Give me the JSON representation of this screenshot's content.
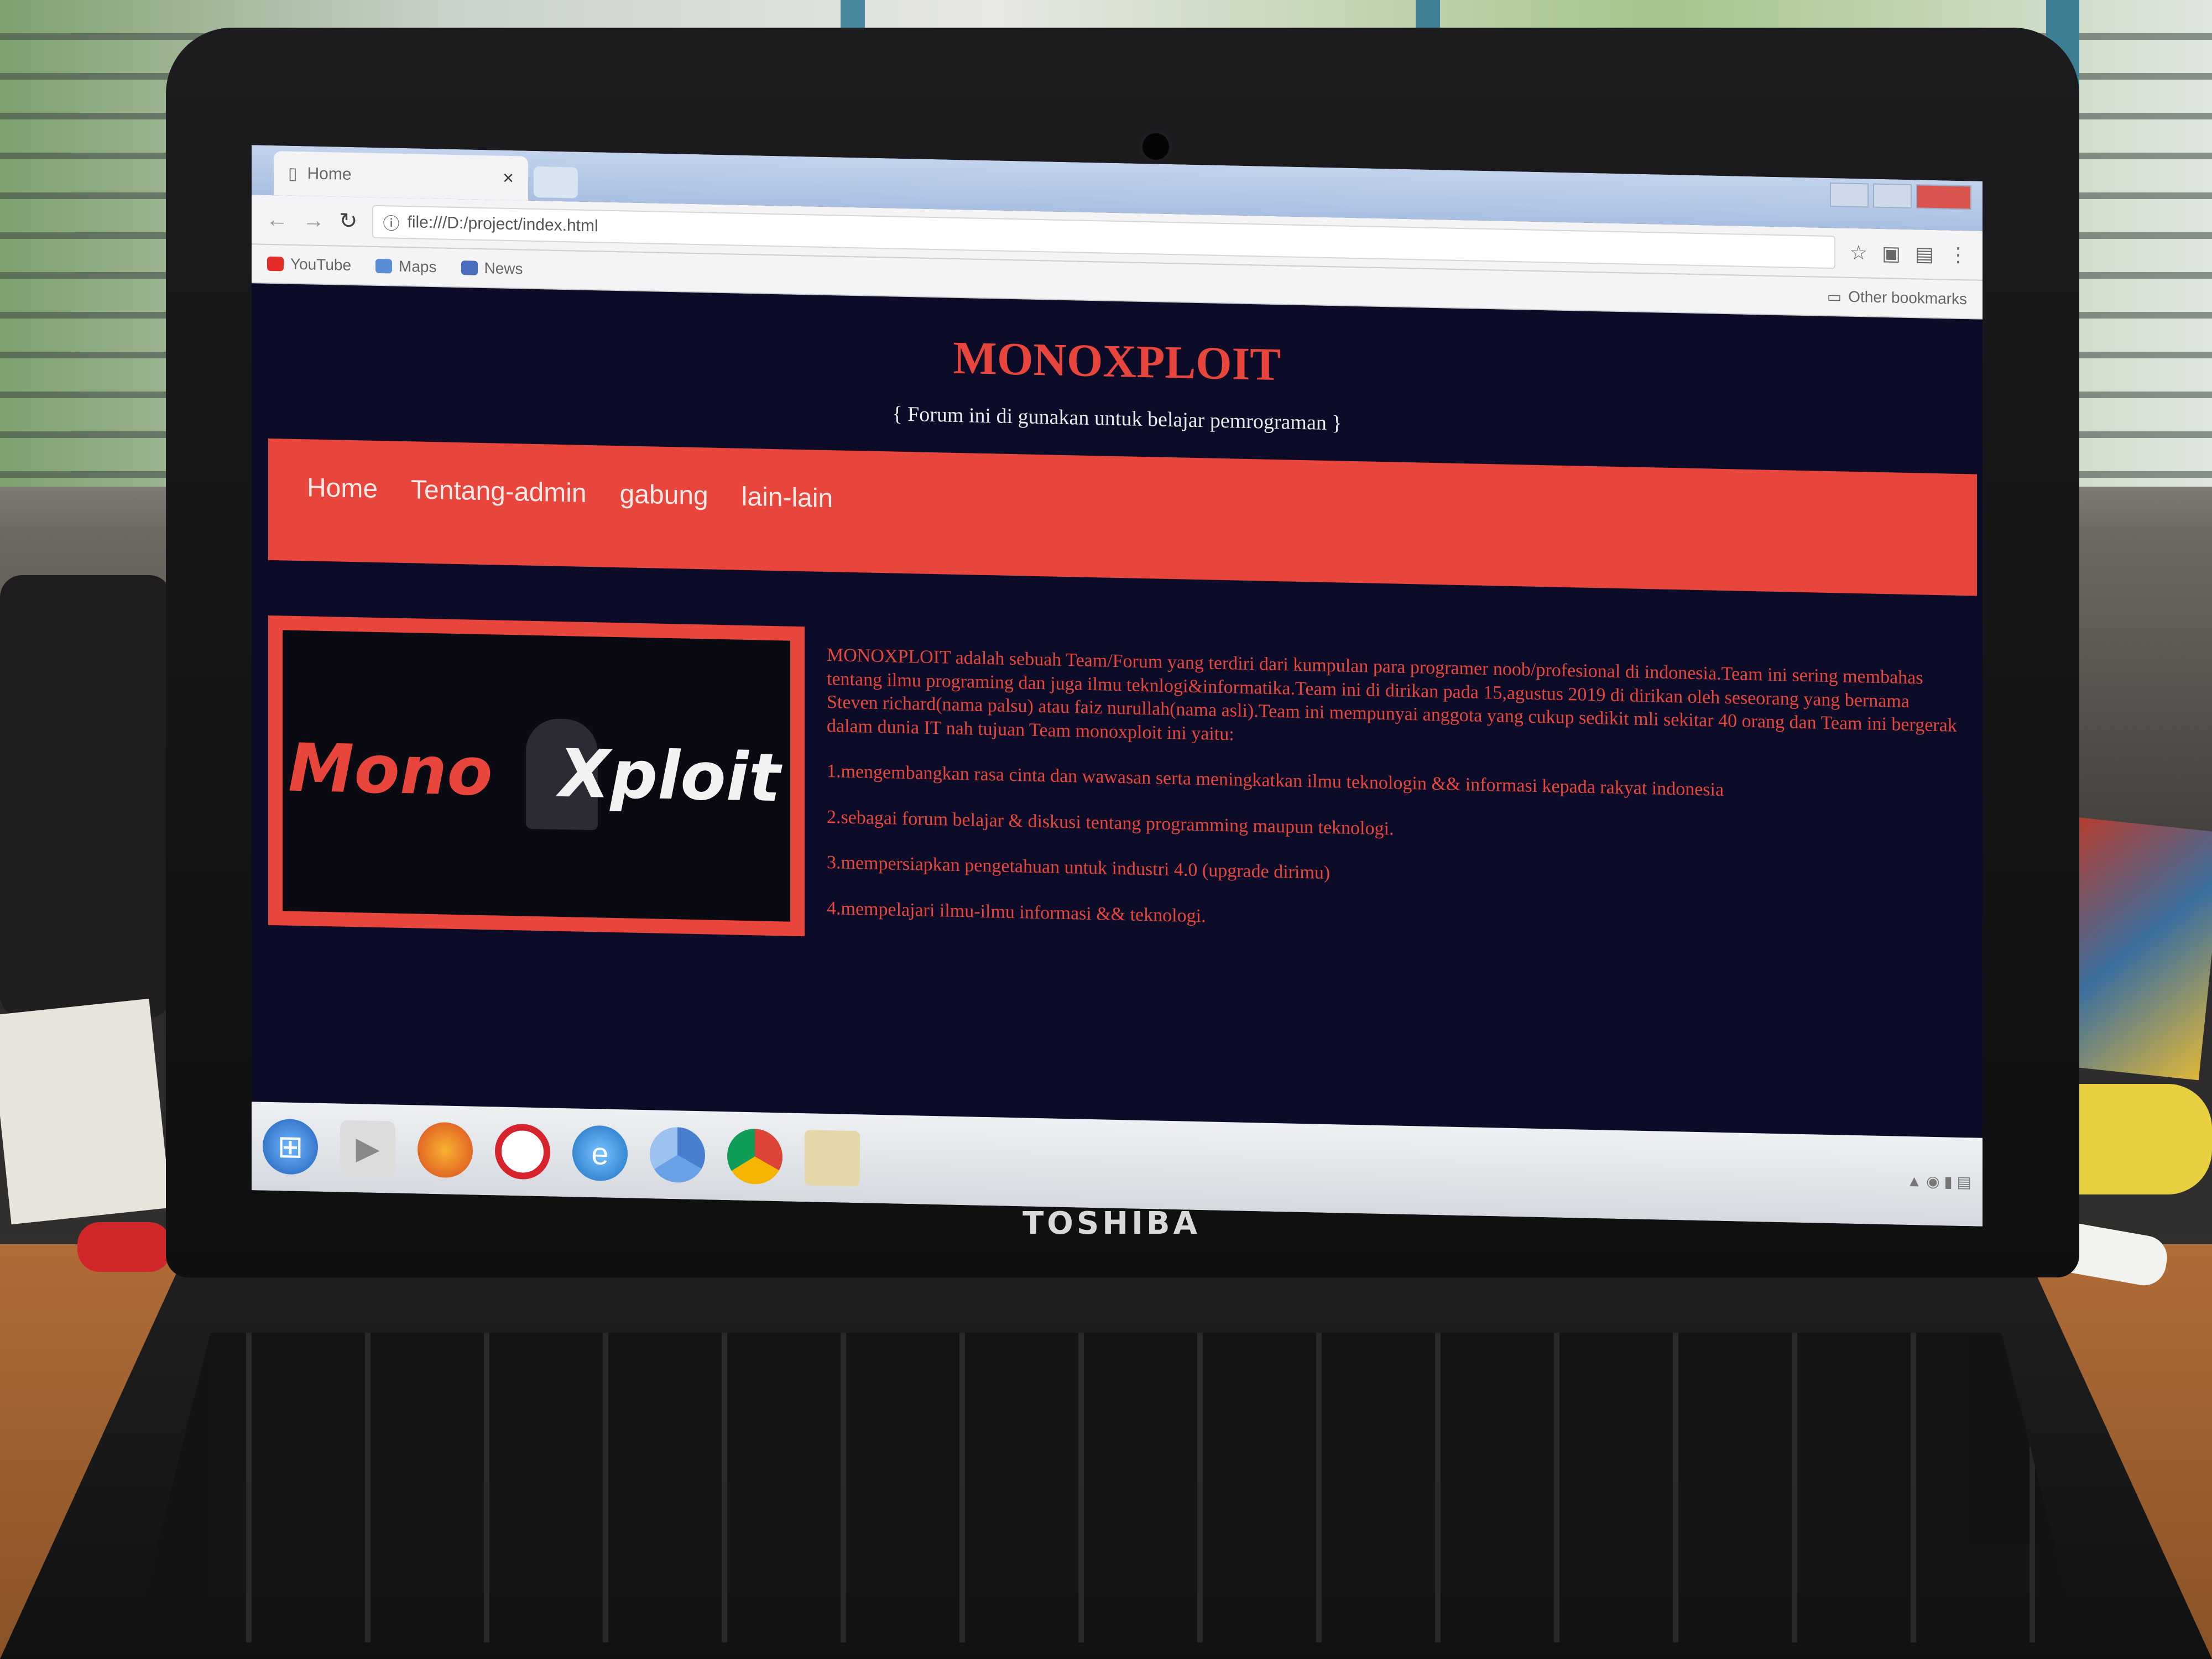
{
  "device": {
    "brand": "TOSHIBA"
  },
  "browser": {
    "tab_title": "Home",
    "tab_close": "×",
    "address": "file:///D:/project/index.html",
    "bookmarks": [
      "YouTube",
      "Maps",
      "News"
    ],
    "other_bookmarks": "Other bookmarks"
  },
  "page": {
    "title": "MONOXPLOIT",
    "tagline": "{ Forum ini di gunakan untuk belajar pemrograman }",
    "nav": [
      "Home",
      "Tentang-admin",
      "gabung",
      "lain-lain"
    ],
    "logo_left": "Mono",
    "logo_right": "Xploit",
    "intro": "MONOXPLOIT adalah sebuah Team/Forum yang terdiri dari kumpulan para programer noob/profesional di indonesia.Team ini sering membahas tentang ilmu programing dan juga ilmu teknlogi&informatika.Team ini di dirikan pada 15,agustus 2019 di dirikan oleh seseorang yang bernama Steven richard(nama palsu) atau faiz nurullah(nama asli).Team ini mempunyai anggota yang cukup sedikit mli sekitar 40 orang dan Team ini bergerak dalam dunia IT nah tujuan Team monoxploit ini yaitu:",
    "goals": [
      "1.mengembangkan rasa cinta dan wawasan serta meningkatkan ilmu teknologin && informasi kepada rakyat indonesia",
      "2.sebagai forum belajar & diskusi tentang programming maupun teknologi.",
      "3.mempersiapkan pengetahuan untuk industri 4.0 (upgrade dirimu)",
      "4.mempelajari ilmu-ilmu informasi && teknologi."
    ]
  },
  "colors": {
    "accent": "#e8453c",
    "page_bg": "#0c0c28"
  },
  "icons": {
    "taskbar": [
      "windows-start-icon",
      "media-player-icon",
      "firefox-icon",
      "opera-icon",
      "internet-explorer-icon",
      "chromium-icon",
      "chrome-icon",
      "folder-icon"
    ]
  }
}
